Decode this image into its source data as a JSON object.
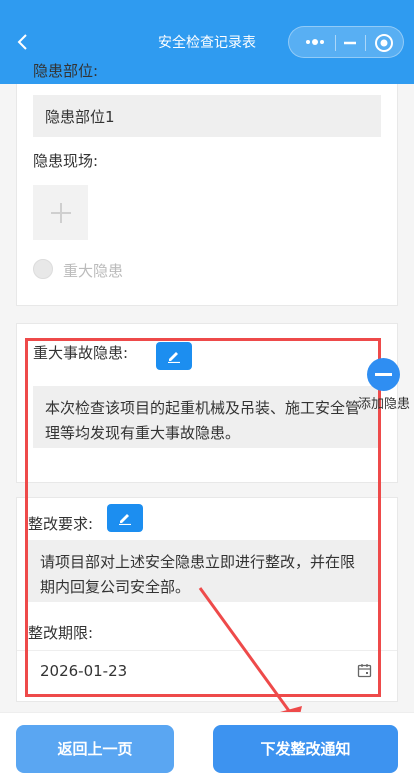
{
  "navbar": {
    "title": "安全检查记录表",
    "back_icon": "chevron-left-icon",
    "capsule_icons": [
      "more-dots-icon",
      "minimize-icon",
      "target-icon"
    ]
  },
  "hazard_section": {
    "location_label": "隐患部位:",
    "location_value": "隐患部位1",
    "site_label": "隐患现场:",
    "upload_icon": "plus-icon",
    "major_label": "重大隐患"
  },
  "major_accident": {
    "label": "重大事故隐患:",
    "text": "本次检查该项目的起重机械及吊装、施工安全管理等均发现有重大事故隐患。"
  },
  "rectification": {
    "requirement_label": "整改要求:",
    "requirement_text": "请项目部对上述安全隐患立即进行整改，并在限期内回复公司安全部。",
    "deadline_label": "整改期限:",
    "deadline_value": "2026-01-23"
  },
  "float_button": {
    "label": "添加隐患"
  },
  "footer": {
    "back_label": "返回上一页",
    "issue_label": "下发整改通知"
  },
  "colors": {
    "primary": "#2f9bf0",
    "annotation": "#ee4a4a"
  }
}
